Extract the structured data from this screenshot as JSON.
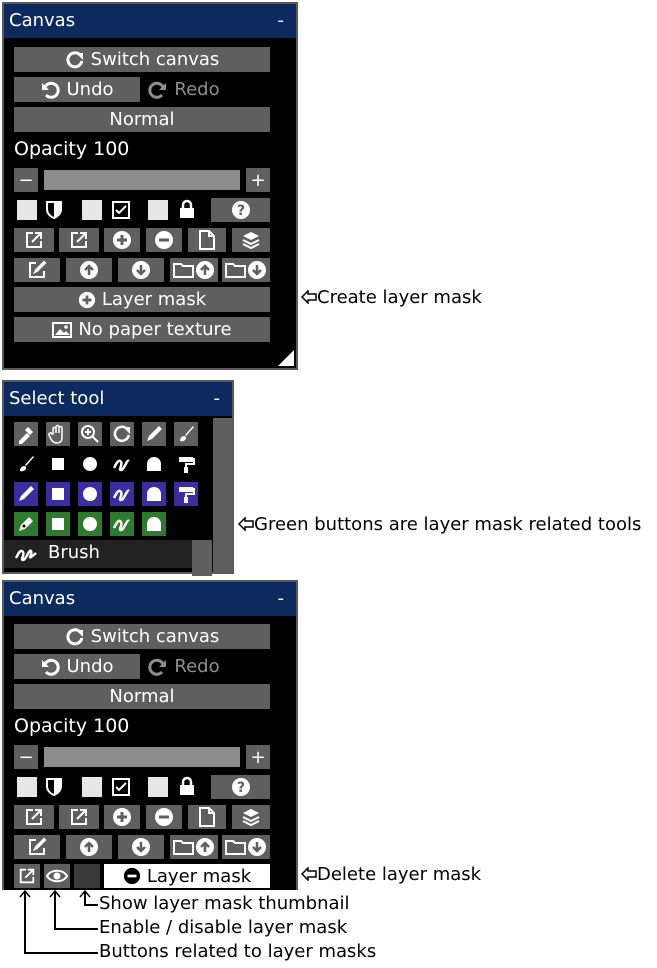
{
  "canvas_panel": {
    "title": "Canvas",
    "minimize": "-",
    "switch_canvas": "Switch canvas",
    "undo": "Undo",
    "redo": "Redo",
    "blend_mode": "Normal",
    "opacity_label": "Opacity 100",
    "opacity": 100,
    "minus": "−",
    "plus": "+",
    "layer_mask_button": "Layer mask",
    "paper_texture": "No paper texture",
    "help": "?"
  },
  "select_tool": {
    "title": "Select tool",
    "minimize": "-",
    "current_tool": "Brush"
  },
  "annotations": {
    "create_mask": "Create layer mask",
    "green_buttons": "Green buttons are layer mask related tools",
    "delete_mask": "Delete layer mask",
    "show_thumbnail": "Show layer mask thumbnail",
    "enable_disable": "Enable / disable layer mask",
    "related_buttons": "Buttons related to layer masks"
  },
  "colors": {
    "title_bg": "#0c2a5e",
    "button_bg": "#5f5f5f",
    "tool_blue": "#3a2fa0",
    "tool_green": "#2e7a2e"
  }
}
